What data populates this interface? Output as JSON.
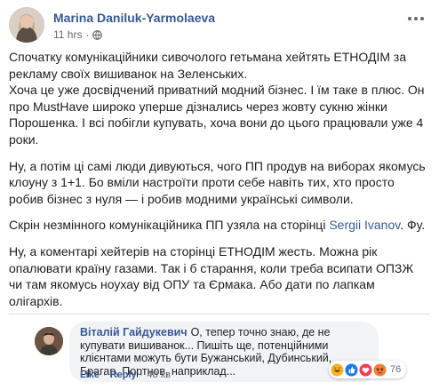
{
  "post": {
    "author": "Marina Daniluk-Yarmolaeva",
    "time": "11 hrs",
    "paragraphs": [
      "Спочатку комунікаційники сивочолого гетьмана хейтять ЕТНОДІМ за рекламу своїх вишиванок на Зеленських.\nХоча це уже досвідчений приватний модний бізнес. І їм таке в плюс. Он про MustHave широко уперше дізнались через жовту сукню жінки Порошенка. І всі побігли купувать, хоча вони до цього працювали уже 4 роки.",
      "Ну, а потім ці самі люди дивуються, чого ПП продув на виборах якомусь клоуну з 1+1. Бо вміли настроїти проти себе навіть тих, хто просто робив бізнес з нуля — і робив модними українські символи.",
      "Ну, а коментарі хейтерів на сторінці ЕТНОДІМ жесть. Можна рік опалювати країну газами. Так і б старання, коли треба всипати ОПЗЖ чи там якомусь ноухау від ОПУ та Єрмака. Або дати по лапкам олігархів."
    ],
    "screenshot_line": {
      "before": "Скрін незмінного комунікаційника ПП узяла на сторінці ",
      "link": "Sergii Ivanov",
      "after": ". Фу."
    }
  },
  "comment": {
    "name": "Віталій Гайдукевич",
    "text": "О, тепер точно знаю, де не купувати вишиванок... Пишіть ще, потенційними клієнтами можуть бути Бужанський, Дубинський, Брагар, Портнов, наприклад...",
    "actions": {
      "like": "Like",
      "reply": "Reply",
      "time": "48 хв"
    },
    "reaction_count": "76",
    "reaction_icons": [
      "haha-icon",
      "like-icon",
      "love-icon",
      "angry-icon"
    ]
  },
  "colors": {
    "link": "#385898",
    "bubble": "#f2f3f5",
    "meta": "#616770"
  }
}
